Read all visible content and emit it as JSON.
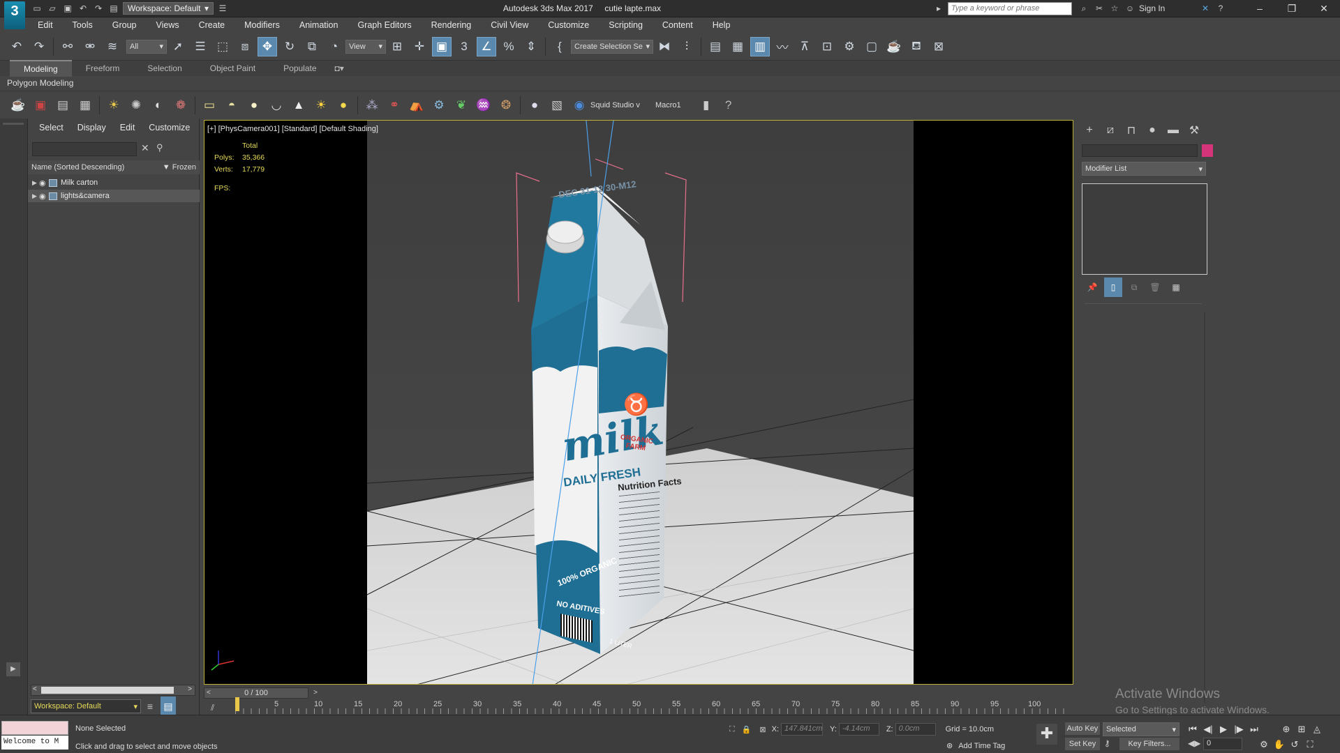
{
  "app": {
    "logo": "3",
    "title": "Autodesk 3ds Max 2017",
    "file": "cutie lapte.max",
    "workspace": "Workspace: Default",
    "search_placeholder": "Type a keyword or phrase",
    "sign_in": "Sign In"
  },
  "menu": [
    "Edit",
    "Tools",
    "Group",
    "Views",
    "Create",
    "Modifiers",
    "Animation",
    "Graph Editors",
    "Rendering",
    "Civil View",
    "Customize",
    "Scripting",
    "Content",
    "Help"
  ],
  "toolbar": {
    "filter": "All",
    "refcoord": "View",
    "selection_set": "Create Selection Se"
  },
  "ribbon_tabs": [
    "Modeling",
    "Freeform",
    "Selection",
    "Object Paint",
    "Populate"
  ],
  "ribbon_sub": "Polygon Modeling",
  "ribbon_labels": {
    "squid": "Squid Studio v",
    "macro": "Macro1"
  },
  "explorer": {
    "menus": [
      "Select",
      "Display",
      "Edit",
      "Customize"
    ],
    "col_name": "Name (Sorted Descending)",
    "col_frozen": "Frozen",
    "items": [
      "Milk carton",
      "lights&camera"
    ],
    "workspace": "Workspace: Default"
  },
  "viewport": {
    "label": "[+] [PhysCamera001] [Standard] [Default Shading]",
    "stats": {
      "total": "Total",
      "polys_label": "Polys:",
      "polys": "35,366",
      "verts_label": "Verts:",
      "verts": "17,779",
      "fps": "FPS:"
    },
    "carton": {
      "date": "DEC 31-12 30-M12",
      "brand": "milk",
      "tagline": "DAILY FRESH",
      "farm": "ORGANIC\nFARM",
      "nutrition": "Nutrition Facts",
      "organic": "100% ORGANIC",
      "no_add": "NO ADITIVES",
      "volume": "1 LITER"
    }
  },
  "command_panel": {
    "modifier_list": "Modifier List",
    "color": "#d6347a"
  },
  "timeline": {
    "frame": "0 / 100",
    "ticks": [
      "5",
      "10",
      "15",
      "20",
      "25",
      "30",
      "35",
      "40",
      "45",
      "50",
      "55",
      "60",
      "65",
      "70",
      "75",
      "80",
      "85",
      "90",
      "95",
      "100"
    ],
    "current": 0
  },
  "status": {
    "maxscript": "Welcome to M",
    "selection": "None Selected",
    "prompt": "Click and drag to select and move objects",
    "x_label": "X:",
    "x": "147.841cm",
    "y_label": "Y:",
    "y": "-4.14cm",
    "z_label": "Z:",
    "z": "0.0cm",
    "grid": "Grid = 10.0cm",
    "add_time_tag": "Add Time Tag",
    "auto_key": "Auto Key",
    "set_key": "Set Key",
    "key_mode": "Selected",
    "key_filters": "Key Filters...",
    "frame_field": "0"
  },
  "watermark": {
    "title": "Activate Windows",
    "sub": "Go to Settings to activate Windows."
  },
  "colors": {
    "accent": "#5b89ad",
    "carton_blue": "#1f6e93",
    "viewport_border": "#bfae3a"
  }
}
